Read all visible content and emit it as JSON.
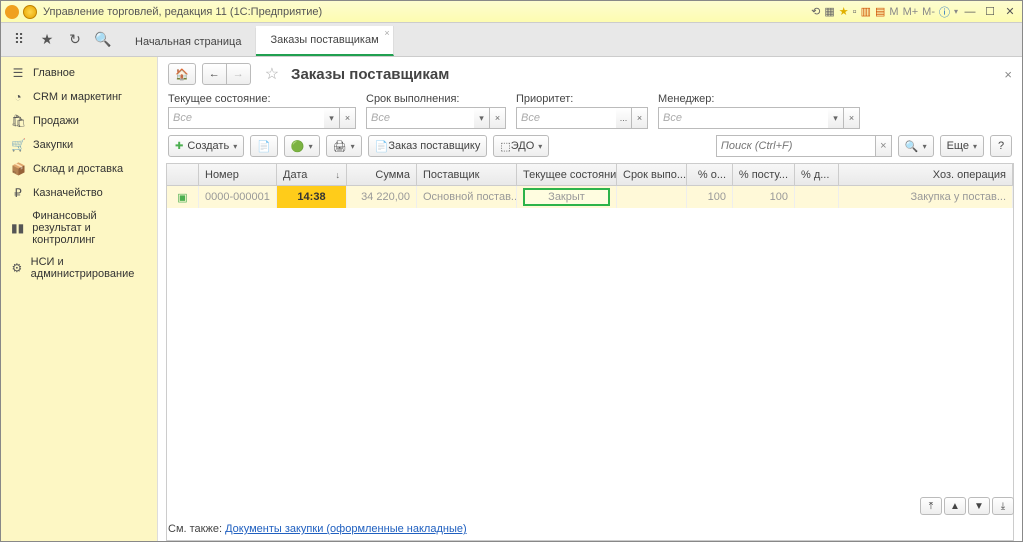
{
  "window": {
    "title": "Управление торговлей, редакция 11  (1С:Предприятие)"
  },
  "top_tabs": {
    "start": "Начальная страница",
    "active": "Заказы поставщикам"
  },
  "sidebar": {
    "items": [
      {
        "label": "Главное"
      },
      {
        "label": "CRM и маркетинг"
      },
      {
        "label": "Продажи"
      },
      {
        "label": "Закупки"
      },
      {
        "label": "Склад и доставка"
      },
      {
        "label": "Казначейство"
      },
      {
        "label": "Финансовый результат и контроллинг"
      },
      {
        "label": "НСИ и администрирование"
      }
    ]
  },
  "page": {
    "title": "Заказы поставщикам"
  },
  "filters": {
    "state": {
      "label": "Текущее состояние:",
      "value": "Все"
    },
    "due": {
      "label": "Срок выполнения:",
      "value": "Все"
    },
    "priority": {
      "label": "Приоритет:",
      "value": "Все"
    },
    "manager": {
      "label": "Менеджер:",
      "value": "Все"
    }
  },
  "toolbar": {
    "create": "Создать",
    "order": "Заказ поставщику",
    "edo": "ЭДО",
    "search_ph": "Поиск (Ctrl+F)",
    "more": "Еще"
  },
  "table": {
    "headers": {
      "num": "Номер",
      "date": "Дата",
      "sum": "Сумма",
      "supplier": "Поставщик",
      "state": "Текущее состояние",
      "due": "Срок выпо...",
      "pay": "% о...",
      "ship": "% посту...",
      "debt": "% д...",
      "op": "Хоз. операция"
    },
    "rows": [
      {
        "num": "0000-000001",
        "date": "14:38",
        "sum": "34 220,00",
        "supplier": "Основной постав...",
        "state": "Закрыт",
        "due": "",
        "pay": "100",
        "ship": "100",
        "debt": "",
        "op": "Закупка у постав..."
      }
    ]
  },
  "footer": {
    "prefix": "См. также: ",
    "link": "Документы закупки (оформленные накладные)"
  },
  "sys": {
    "m": "M",
    "mplus": "M+",
    "mminus": "M-"
  }
}
